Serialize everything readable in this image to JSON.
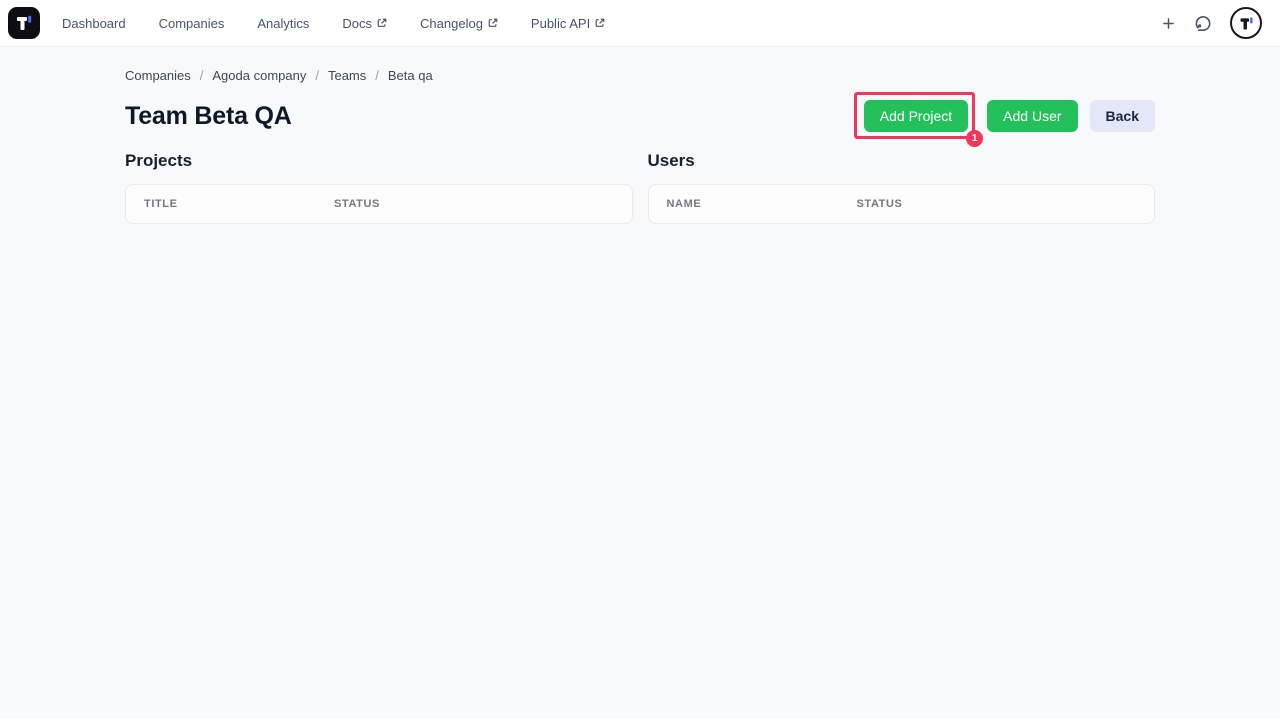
{
  "navbar": {
    "items": [
      {
        "label": "Dashboard",
        "external": false
      },
      {
        "label": "Companies",
        "external": false
      },
      {
        "label": "Analytics",
        "external": false
      },
      {
        "label": "Docs",
        "external": true
      },
      {
        "label": "Changelog",
        "external": true
      },
      {
        "label": "Public API",
        "external": true
      }
    ]
  },
  "breadcrumb": {
    "items": [
      "Companies",
      "Agoda company",
      "Teams",
      "Beta qa"
    ],
    "separator": "/"
  },
  "page": {
    "title": "Team Beta QA"
  },
  "actions": {
    "add_project": "Add Project",
    "add_user": "Add User",
    "back": "Back"
  },
  "annotation": {
    "step": "1"
  },
  "sections": {
    "projects": {
      "heading": "Projects",
      "columns": [
        "TITLE",
        "STATUS"
      ],
      "rows": []
    },
    "users": {
      "heading": "Users",
      "columns": [
        "NAME",
        "STATUS"
      ],
      "rows": []
    }
  },
  "colors": {
    "primary_green": "#23c05c",
    "annotation_red": "#f5365c",
    "back_button_bg": "#e4e7f7",
    "brand_blue": "#4f6ef7",
    "page_background": "#f8f9fb"
  }
}
